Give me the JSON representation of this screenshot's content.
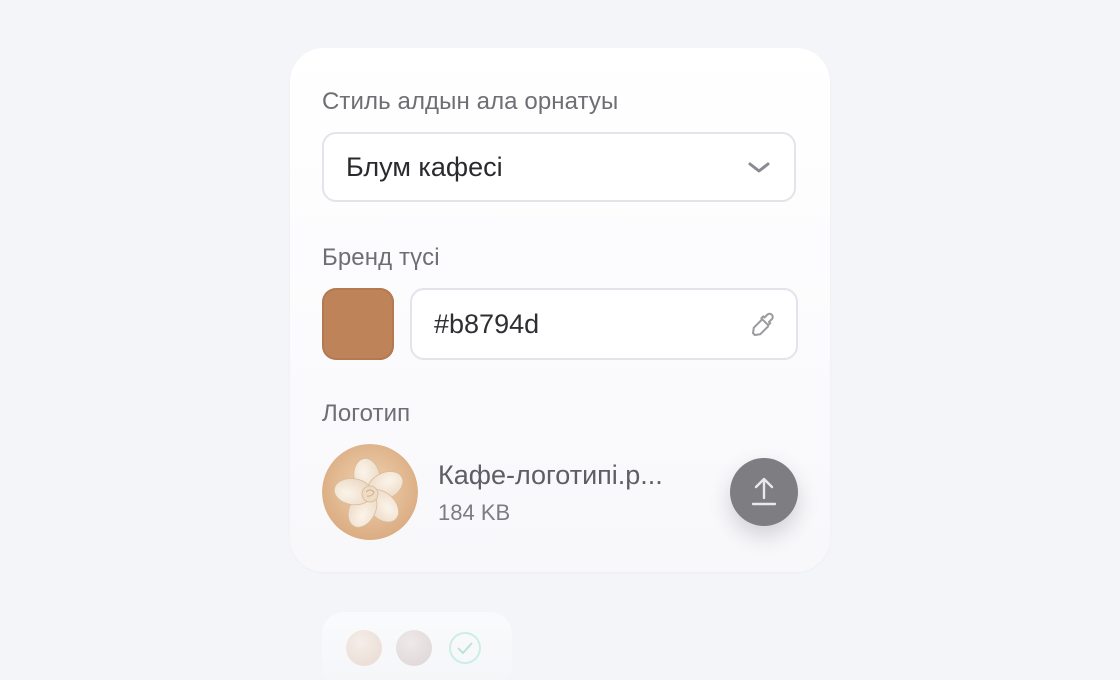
{
  "style_preset": {
    "label": "Стиль алдын ала орнатуы",
    "selected": "Блум кафесі"
  },
  "brand_color": {
    "label": "Бренд түсі",
    "hex": "#b8794d",
    "swatch_color": "#bf8359",
    "picker_icon": "eyedropper-icon"
  },
  "logo": {
    "label": "Логотип",
    "file_name": "Кафе-логотипі.р...",
    "file_size": "184 KB",
    "upload_icon": "upload-icon"
  },
  "colors": {
    "page_background": "#f4f5f8",
    "card_background": "#ffffff",
    "upload_button": "#7d7d82"
  }
}
